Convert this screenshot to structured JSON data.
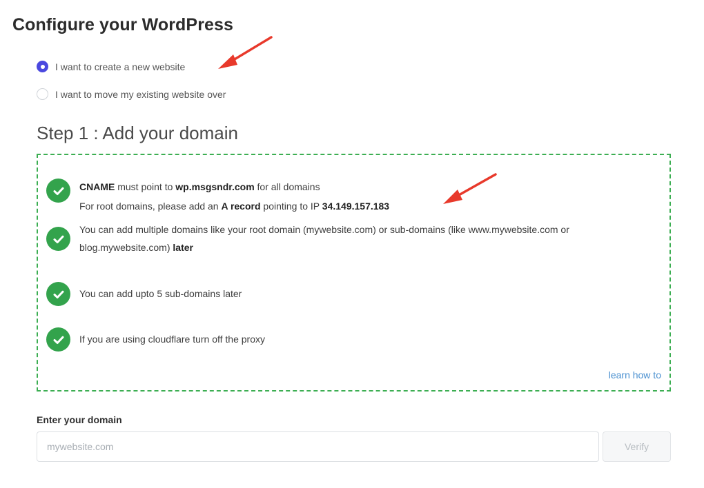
{
  "page": {
    "title": "Configure your WordPress"
  },
  "options": [
    {
      "label": "I want to create a new website",
      "selected": true
    },
    {
      "label": "I want to move my existing website over",
      "selected": false
    }
  ],
  "step": {
    "title": "Step 1 : Add your domain"
  },
  "info": {
    "item1": {
      "line1_bold_a": "CNAME",
      "line1_text_a": " must point to ",
      "line1_bold_b": "wp.msgsndr.com",
      "line1_text_b": " for all domains",
      "line2_text_a": "For root domains, please add an ",
      "line2_bold_a": "A record",
      "line2_text_b": " pointing to IP ",
      "line2_bold_b": "34.149.157.183"
    },
    "item2": {
      "text": "You can add multiple domains like your root domain (mywebsite.com) or sub-domains (like www.mywebsite.com or blog.mywebsite.com) ",
      "bold": "later"
    },
    "item3": {
      "text": "You can add upto 5 sub-domains later"
    },
    "item4": {
      "text": "If you are using cloudflare turn off the proxy"
    },
    "learn_link": "learn how to"
  },
  "domain": {
    "label": "Enter your domain",
    "placeholder": "mywebsite.com",
    "value": "",
    "verify_label": "Verify"
  },
  "colors": {
    "accent": "#4a48df",
    "success": "#33a34c",
    "link": "#4a90d0",
    "annotation": "#e8392b"
  },
  "icons": [
    "check-circle-icon",
    "arrow-annotation-icon"
  ]
}
